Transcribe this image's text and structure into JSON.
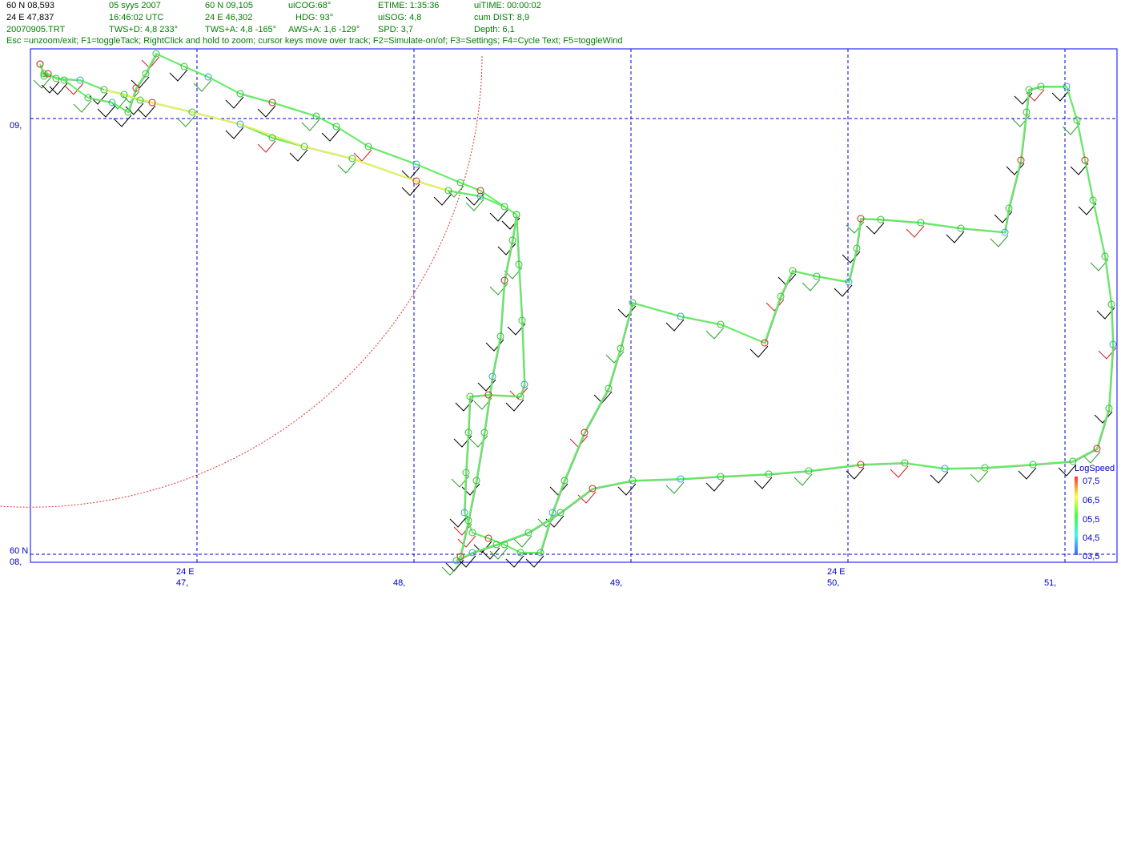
{
  "header": {
    "lat": "60 N 08,593",
    "lon": "24 E 47,837",
    "file": "20070905.TRT",
    "date": "05 syys 2007",
    "time": "16:46:02  UTC",
    "tws_d": "TWS+D: 4,8 233°",
    "cursor_lat": "60 N 09,105",
    "cursor_lon": "24 E 46,302",
    "tws_a": "TWS+A: 4,8 -165°",
    "cog": "uiCOG:68°",
    "hdg": "HDG: 93°",
    "aws_a": "AWS+A: 1,6 -129°",
    "etime": "ETIME: 1:35:36",
    "sog": "uiSOG: 4,8",
    "spd": "SPD: 3,7",
    "itime": "uiTIME: 00:00:02",
    "cum_dist": "cum DIST: 8,9",
    "depth": "Depth: 6,1"
  },
  "help_text": "Esc =unzoom/exit; F1=toggleTack; RightClick and hold to zoom; cursor keys move over track; F2=Simulate-on/of; F3=Settings; F4=Cycle Text; F5=toggleWind",
  "axes": {
    "y_labels": [
      "09,",
      "60 N",
      "08,"
    ],
    "x_deg": "24 E",
    "x_labels": [
      "47,",
      "48,",
      "49,",
      "50,",
      "51,"
    ]
  },
  "legend": {
    "title": "LogSpeed",
    "ticks": [
      "07,5",
      "06,5",
      "05,5",
      "04,5",
      "03,5"
    ]
  },
  "colors": {
    "accent": "#0000ff",
    "track": "#7cf07c",
    "grid": "#0000cc",
    "circle": "#d02020"
  }
}
